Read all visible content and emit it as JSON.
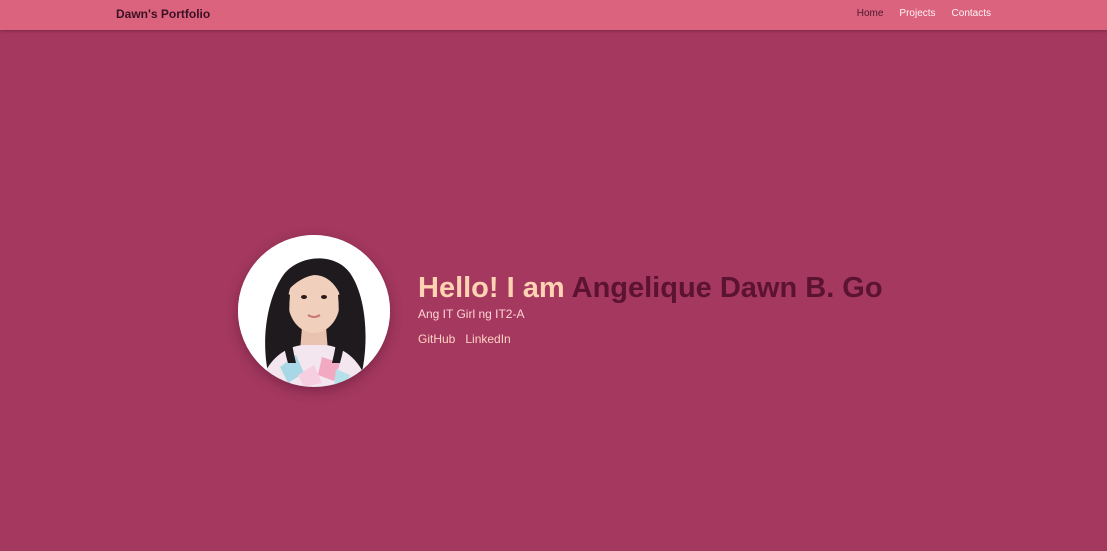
{
  "navbar": {
    "brand": "Dawn's Portfolio",
    "links": [
      {
        "label": "Home",
        "active": true
      },
      {
        "label": "Projects",
        "active": false
      },
      {
        "label": "Contacts",
        "active": false
      }
    ]
  },
  "hero": {
    "avatar_icon": "profile-photo",
    "greeting": "Hello! I am ",
    "name": "Angelique Dawn B. Go",
    "tagline": "Ang IT Girl ng IT2-A",
    "social_links": [
      "GitHub",
      "LinkedIn"
    ]
  },
  "colors": {
    "background": "#a4385f",
    "navbar": "#db637d",
    "brand_text": "#3a1024",
    "greeting": "#ffd2b3",
    "name": "#5c1331"
  }
}
